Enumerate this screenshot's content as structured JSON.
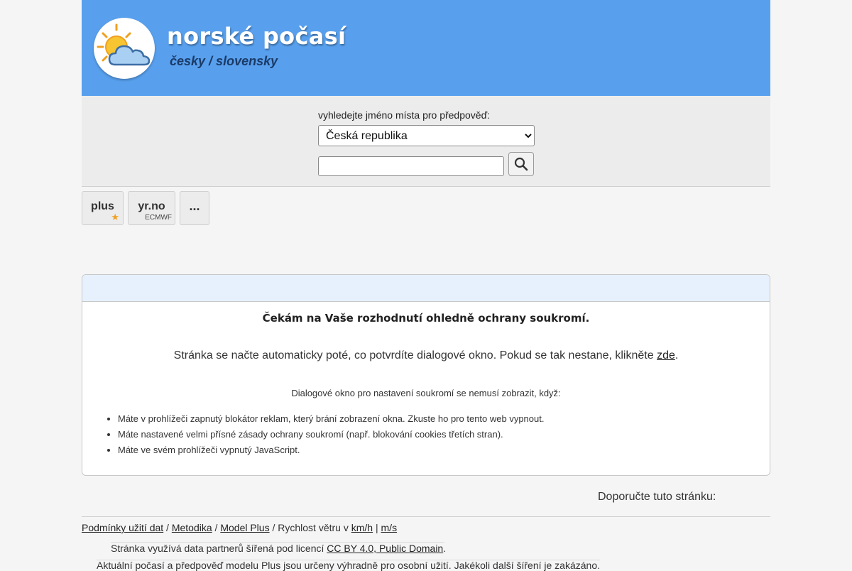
{
  "header": {
    "title": "norské počasí",
    "subtitle": "česky / slovensky",
    "logo_icon": "sun-behind-cloud-icon"
  },
  "search": {
    "label": "vyhledejte jméno místa pro předpověď:",
    "country_selected": "Česká republika",
    "place_value": "",
    "button_icon": "magnifier-icon"
  },
  "tabs": {
    "plus": {
      "label": "plus",
      "icon": "star-icon"
    },
    "yr": {
      "label": "yr.no",
      "sublabel": "ECMWF"
    },
    "more": {
      "label": "..."
    }
  },
  "privacy": {
    "title": "Čekám na Vaše rozhodnutí ohledně ochrany soukromí.",
    "message_before": "Stránka se načte automaticky poté, co potvrdíte dialogové okno. Pokud se tak nestane, klikněte",
    "message_link": "zde",
    "message_after": ".",
    "note": "Dialogové okno pro nastavení soukromí se nemusí zobrazit, když:",
    "reasons": [
      "Máte v prohlížeči zapnutý blokátor reklam, který brání zobrazení okna. Zkuste ho pro tento web vypnout.",
      "Máte nastavené velmi přísné zásady ochrany soukromí (např. blokování cookies třetích stran).",
      "Máte ve svém prohlížeči vypnutý JavaScript."
    ]
  },
  "footer": {
    "recommend": "Doporučte tuto stránku:",
    "links": {
      "terms": "Podmínky užití dat",
      "sep1": " / ",
      "method": "Metodika",
      "sep2": " / ",
      "model_plus": "Model Plus",
      "wind_text": " / Rychlost větru v ",
      "kmh": "km/h",
      "sep3": " | ",
      "ms": "m/s"
    },
    "license_text": "Stránka využívá data partnerů šířená pod licencí",
    "license_link": "CC BY 4.0, Public Domain",
    "license_end": ".",
    "usage": "Aktuální počasí a předpověď modelu Plus jsou určeny výhradně pro osobní užití. Jakékoli další šíření je zakázáno."
  }
}
